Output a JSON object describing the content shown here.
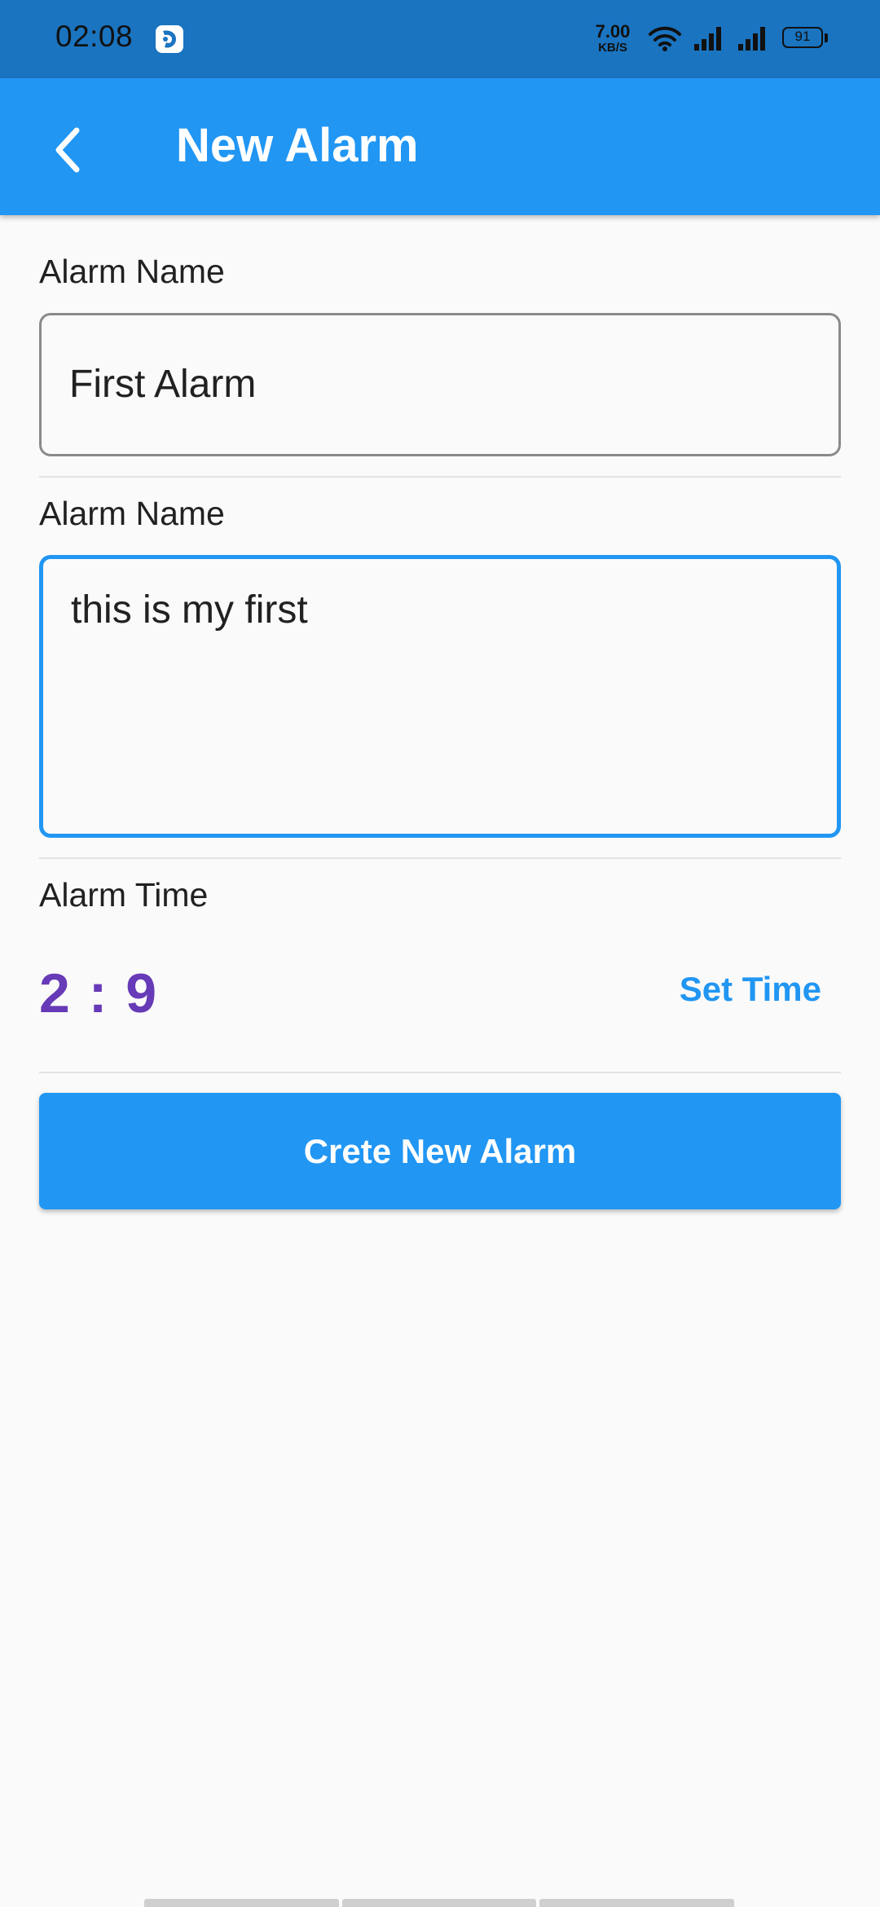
{
  "status_bar": {
    "time": "02:08",
    "net_speed_value": "7.00",
    "net_speed_unit": "KB/S",
    "battery": "91",
    "icons": [
      "app-notification-icon",
      "wifi-icon",
      "signal-icon",
      "signal-icon",
      "battery-icon"
    ]
  },
  "app_bar": {
    "title": "New Alarm",
    "back_icon": "chevron-left-icon",
    "color": "#2196f3"
  },
  "form": {
    "name_label": "Alarm Name",
    "name_value": "First Alarm",
    "description_label": "Alarm Name",
    "description_value": "this is my first",
    "time_label": "Alarm Time",
    "time_value": "2 : 9",
    "time_color": "#673ab7",
    "set_time_label": "Set Time",
    "create_button_label": "Crete New Alarm"
  }
}
